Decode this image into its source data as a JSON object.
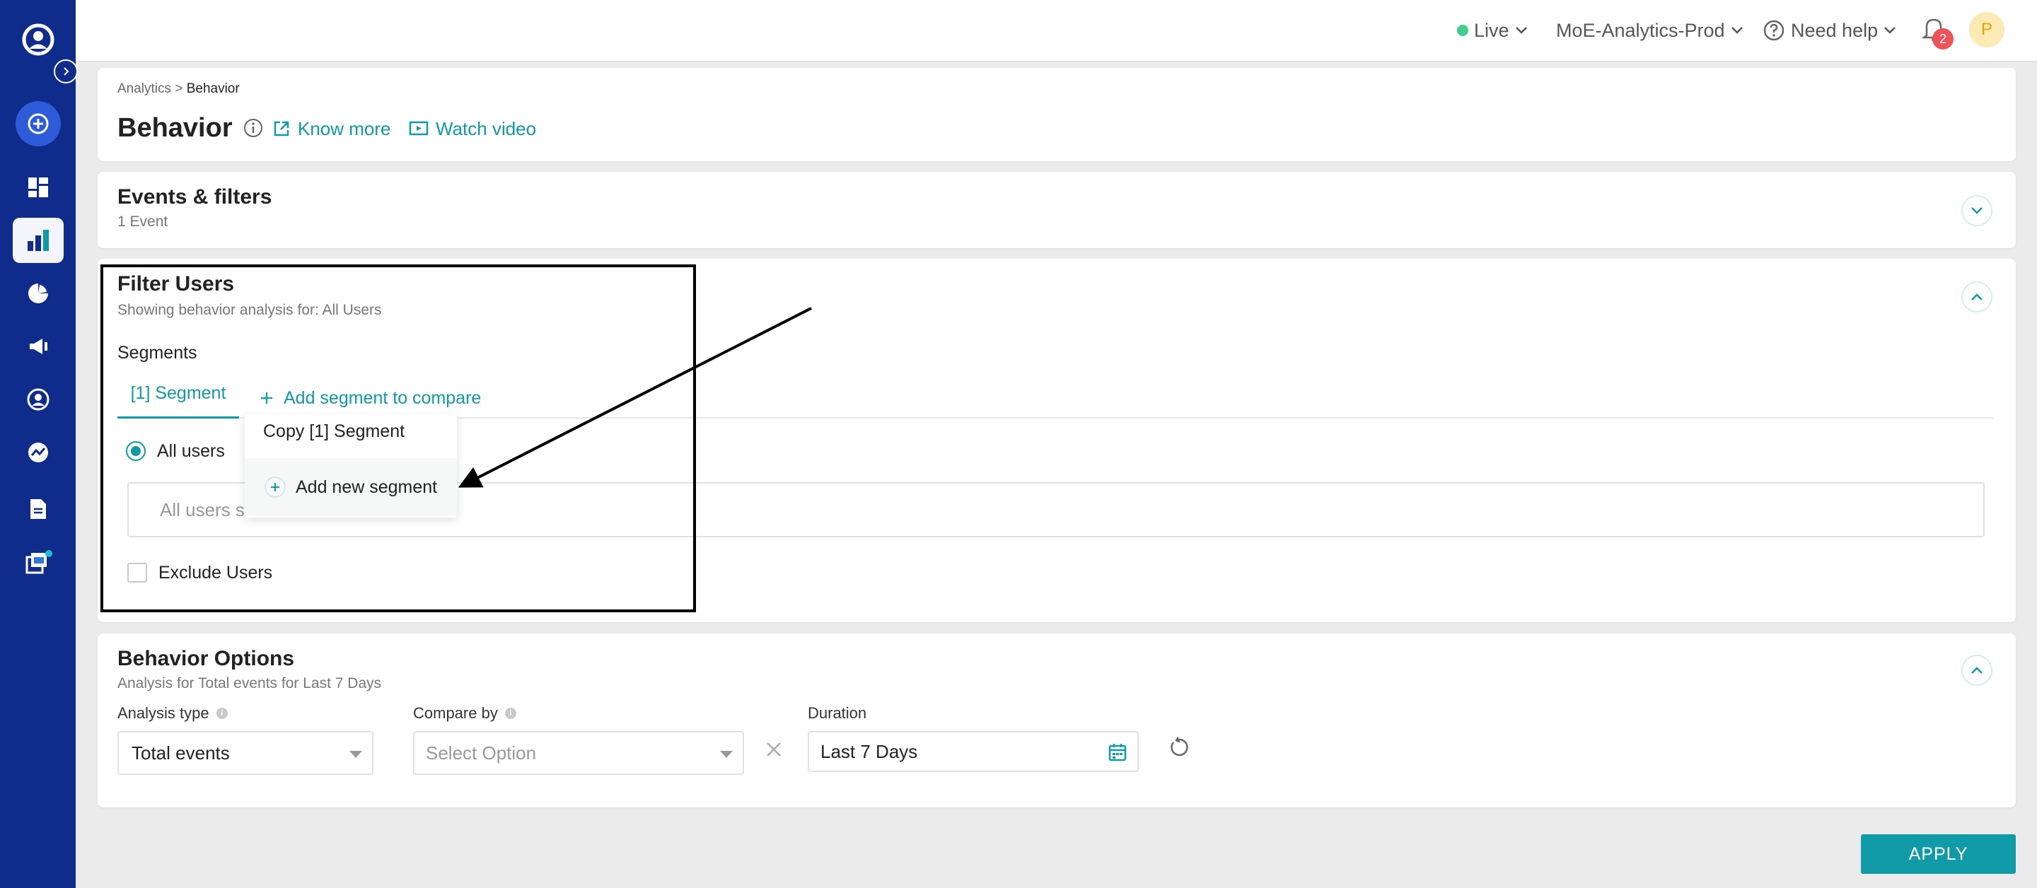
{
  "header": {
    "live_label": "Live",
    "workspace": "MoE-Analytics-Prod",
    "help_label": "Need help",
    "notification_count": "2",
    "avatar_initial": "P",
    "colors": {
      "live_dot": "#3ecf8e",
      "badge": "#f0525a",
      "avatar_bg": "#fbeab4"
    }
  },
  "sidebar": {
    "items": [
      {
        "icon": "profile-icon"
      },
      {
        "icon": "expand-icon"
      },
      {
        "icon": "plus-icon"
      },
      {
        "icon": "dashboard-icon"
      },
      {
        "icon": "analytics-icon",
        "active": true
      },
      {
        "icon": "pie-chart-icon"
      },
      {
        "icon": "megaphone-icon"
      },
      {
        "icon": "user-icon"
      },
      {
        "icon": "trend-icon"
      },
      {
        "icon": "document-icon"
      },
      {
        "icon": "library-icon"
      }
    ]
  },
  "page": {
    "breadcrumb_root": "Analytics",
    "breadcrumb_sep": ">",
    "breadcrumb_current": "Behavior",
    "title": "Behavior",
    "know_more": "Know more",
    "watch_video": "Watch video"
  },
  "events": {
    "title": "Events & filters",
    "subtitle": "1 Event"
  },
  "filter_users": {
    "title": "Filter Users",
    "subtitle": "Showing behavior analysis for: All Users",
    "segments_label": "Segments",
    "segment_tab": "[1] Segment",
    "add_compare": "Add segment to compare",
    "radio_label": "All users",
    "input_placeholder": "All users se",
    "exclude_label": "Exclude Users",
    "menu": {
      "copy": "Copy [1] Segment",
      "add_new": "Add new segment"
    }
  },
  "behavior_options": {
    "title": "Behavior Options",
    "subtitle": "Analysis for Total events for Last 7 Days",
    "analysis_type_label": "Analysis type",
    "analysis_type_value": "Total events",
    "compare_by_label": "Compare by",
    "compare_by_placeholder": "Select Option",
    "duration_label": "Duration",
    "duration_value": "Last 7 Days"
  },
  "apply_label": "APPLY",
  "colors": {
    "accent": "#0e9aa7",
    "sidebar": "#0f2b8c"
  }
}
